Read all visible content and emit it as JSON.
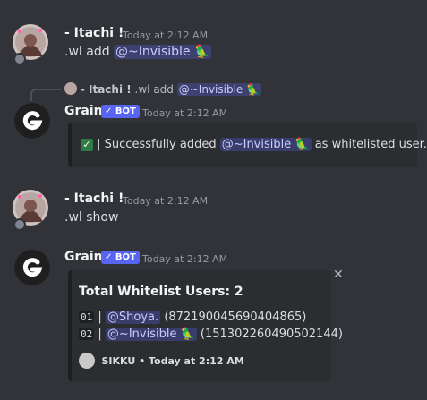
{
  "messages": [
    {
      "author": "- Itachi !",
      "timestamp": "Today at 2:12 AM",
      "content_prefix": ".wl add",
      "mention": "@~Invisible"
    },
    {
      "reply": {
        "author": "- Itachi !",
        "content_prefix": ".wl add",
        "mention": "@~Invisible"
      },
      "author": "Grain",
      "badge": "BOT",
      "timestamp": "Today at 2:12 AM",
      "embed": {
        "check": "✓",
        "text_prefix": "| Successfully added",
        "mention": "@~Invisible",
        "text_suffix": "as whitelisted user."
      }
    },
    {
      "author": "- Itachi !",
      "timestamp": "Today at 2:12 AM",
      "content": ".wl show"
    },
    {
      "author": "Grain",
      "badge": "BOT",
      "timestamp": "Today at 2:12 AM",
      "embed": {
        "title": "Total Whitelist Users: 2",
        "rows": [
          {
            "num": "01",
            "sep": "|",
            "mention": "@Shoya.",
            "id": "(872190045690404865)"
          },
          {
            "num": "02",
            "sep": "|",
            "mention": "@~Invisible",
            "id": "(151302260490502144)"
          }
        ],
        "footer": "SIKKU • Today at 2:12 AM",
        "close": "✕"
      }
    }
  ],
  "colors": {
    "background": "#313338",
    "embed_bg": "#2b2d31",
    "mention_bg": "#5865f2",
    "bot_badge": "#5865f2"
  }
}
